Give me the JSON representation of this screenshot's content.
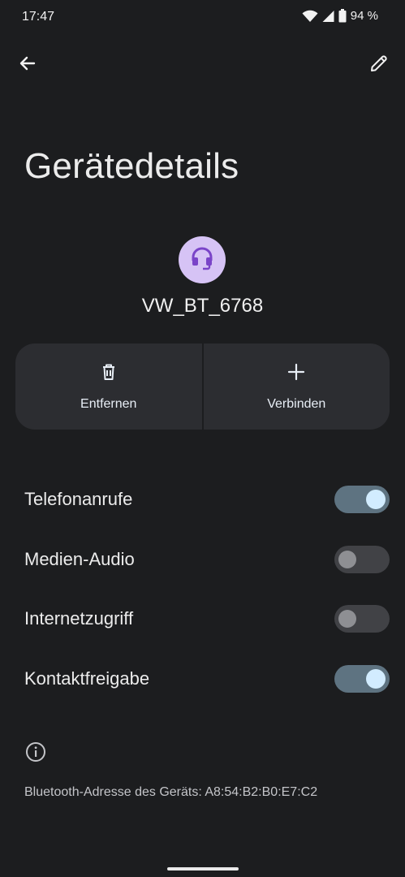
{
  "status_bar": {
    "time": "17:47",
    "battery": "94 %",
    "icons": [
      "wifi-icon",
      "signal-icon",
      "battery-icon"
    ]
  },
  "toolbar": {
    "back_icon": "arrow-back-icon",
    "edit_icon": "pencil-icon"
  },
  "page": {
    "title": "Gerätedetails"
  },
  "device": {
    "icon": "headset-icon",
    "name": "VW_BT_6768",
    "avatar_color": "#d6c3f5",
    "icon_color": "#7a44c8"
  },
  "actions": [
    {
      "label": "Entfernen",
      "icon": "trash-icon"
    },
    {
      "label": "Verbinden",
      "icon": "plus-icon"
    }
  ],
  "settings": [
    {
      "label": "Telefonanrufe",
      "enabled": true
    },
    {
      "label": "Medien-Audio",
      "enabled": false
    },
    {
      "label": "Internetzugriff",
      "enabled": false
    },
    {
      "label": "Kontaktfreigabe",
      "enabled": true
    }
  ],
  "footer": {
    "info_icon": "info-icon",
    "bt_address": "Bluetooth-Adresse des Geräts: A8:54:B2:B0:E7:C2"
  },
  "colors": {
    "background": "#1c1d1f",
    "panel": "#2c2d31",
    "switch_on_track": "#5e7381",
    "switch_on_thumb": "#d2ecff",
    "switch_off_track": "#414246",
    "switch_off_thumb": "#8e8f93"
  }
}
